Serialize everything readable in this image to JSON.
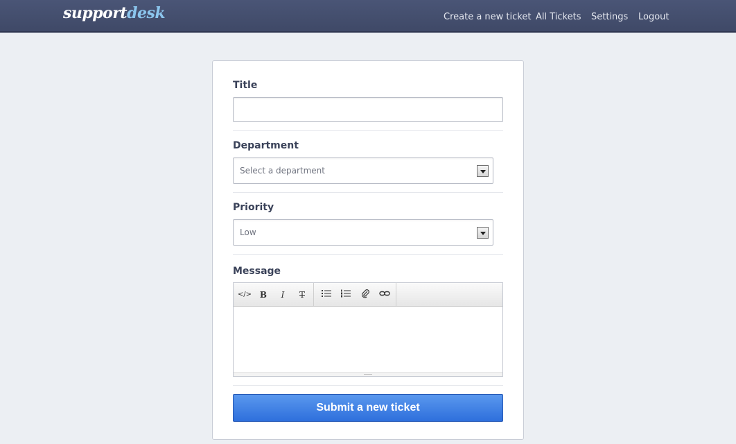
{
  "brand": {
    "part1": "support",
    "part2": "desk"
  },
  "nav": {
    "create": "Create a new ticket",
    "all": "All Tickets",
    "settings": "Settings",
    "logout": "Logout"
  },
  "form": {
    "title_label": "Title",
    "title_value": "",
    "department_label": "Department",
    "department_value": "Select a department",
    "priority_label": "Priority",
    "priority_value": "Low",
    "message_label": "Message",
    "message_value": "",
    "submit_label": "Submit a new ticket"
  },
  "toolbar": {
    "html": "</>",
    "bold": "B",
    "italic": "I",
    "strike": "T",
    "icons": [
      "code-icon",
      "bold-icon",
      "italic-icon",
      "strikethrough-icon",
      "bullet-list-icon",
      "numbered-list-icon",
      "attachment-icon",
      "link-icon"
    ]
  },
  "colors": {
    "topbar": "#434e6e",
    "logo_accent": "#8cc6ee",
    "submit": "#3d7fe3",
    "label": "#3a4259"
  }
}
